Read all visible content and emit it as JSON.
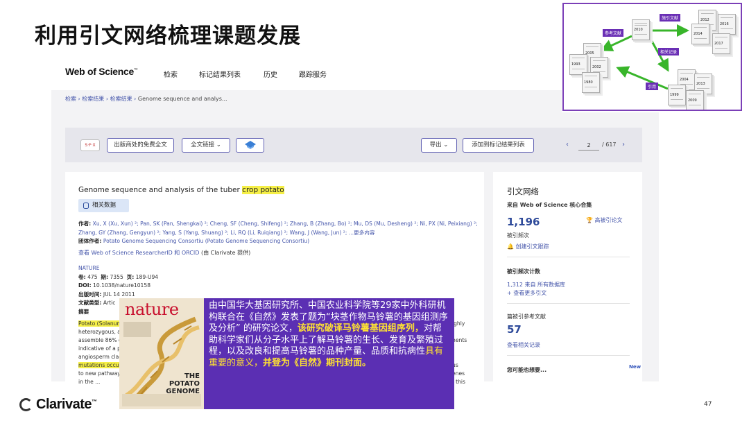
{
  "slide": {
    "title": "利用引文网络梳理课题发展",
    "page_number": "47"
  },
  "network": {
    "tags": {
      "refs": "参考文献",
      "cited": "施引文献",
      "related": "相关记录",
      "citation": "引用"
    },
    "years": [
      "2010",
      "2012",
      "2016",
      "2014",
      "2017",
      "2005",
      "1993",
      "2002",
      "1980",
      "2004",
      "2013",
      "1999",
      "2009"
    ]
  },
  "wos": {
    "logo": "Web of Science",
    "logo_tm": "™",
    "nav": [
      "检索",
      "标记结果列表",
      "历史",
      "跟踪服务"
    ],
    "breadcrumb": [
      "检索",
      "检索结果",
      "检索结果"
    ],
    "breadcrumb_current": "Genome sequence and analys...",
    "toolbar": {
      "sfx": "S·F·X",
      "free_fulltext": "出版商处的免费全文",
      "fulltext_links": "全文链接",
      "export": "导出",
      "add_to_marked": "添加到标记结果列表",
      "page_current": "2",
      "page_total": "/ 617"
    },
    "article": {
      "title_prefix": "Genome sequence and analysis of the tuber ",
      "title_highlight": "crop potato",
      "related_data": "相关数据",
      "authors_label": "作者:",
      "authors_l1": "Xu, X (Xu, Xun) ²; Pan, SK (Pan, Shengkai) ²; Cheng, SF (Cheng, Shifeng) ²; Zhang, B (Zhang, Bo) ²; Mu, DS (Mu, Desheng) ²; Ni, PX (Ni, Peixiang) ²;",
      "authors_l2": "Zhang, GY (Zhang, Gengyun) ²; Yang, S (Yang, Shuang) ²; Li, RQ (Li, Ruiqiang) ²; Wang, J (Wang, Jun) ²; ...更多内容",
      "group_label": "团体作者:",
      "group_value": "Potato Genome Sequencing Consortiu (Potato Genome Sequencing Consortiu)",
      "researcher_link": "查看 Web of Science ResearcherID 和 ORCID",
      "researcher_suffix": " (由 Clarivate 提供)",
      "journal": "NATURE",
      "vol_label": "卷:",
      "vol": "475",
      "issue_label": "期:",
      "issue": "7355",
      "pages_label": "页:",
      "pages": "189-U94",
      "doi_label": "DOI:",
      "doi": "10.1038/nature10158",
      "pubdate_label": "出版时间:",
      "pubdate": "JUL 14 2011",
      "doctype_label": "文献类型:",
      "doctype": "Artic",
      "abstract_label": "摘要",
      "abstract_lines": [
        "Potato (Solanum",
        "heterozygous, a",
        "assemble 86% o",
        "indicative of a p",
        "angiosperm clad",
        "mutations occu",
        "to new pathway",
        "in the ..."
      ],
      "abstract_right": [
        "ighly",
        "nents",
        "us",
        "enes",
        "f this"
      ]
    },
    "right_panel": {
      "title": "引文网络",
      "source": "来自 Web of Science 核心合集",
      "times_cited": "1,196",
      "times_cited_label": "被引频次",
      "highly_cited": "高被引论文",
      "create_alert": "创建引文跟踪",
      "cited_count_title": "被引频次计数",
      "all_db": "1,312 来自 所有数据库",
      "more_citations": "查看更多引文",
      "refs_title": "篇被引参考文献",
      "refs_count": "57",
      "view_related": "查看相关记录",
      "may_also_like": "您可能也想要...",
      "new_badge": "New"
    }
  },
  "overlay": {
    "cover_masthead": "nature",
    "cover_title": "THE POTATO GENOME",
    "text_p1": "由中国华大基因研究所、中国农业科学院等29家中外科研机构联合在《自然》发表了题为“块茎作物马铃薯的基因组测序及分析” 的研究论文，",
    "text_p2": "该研究破译马铃薯基因组序列，",
    "text_p3": "对帮助科学家们从分子水平上了解马铃薯的生长、发育及繁殖过程，以及改良和提高马铃薯的品种产量、品质和抗病性",
    "text_p4": "具有重要的意义，",
    "text_p5": "并登为《自然》期刊封面。"
  },
  "footer": {
    "brand": "Clarivate",
    "brand_tm": "™"
  },
  "colors": {
    "accent": "#5b2fb3",
    "highlight": "#f5ef46",
    "link": "#4455aa",
    "number": "#2e4a9a",
    "arrow": "#38b52a"
  }
}
